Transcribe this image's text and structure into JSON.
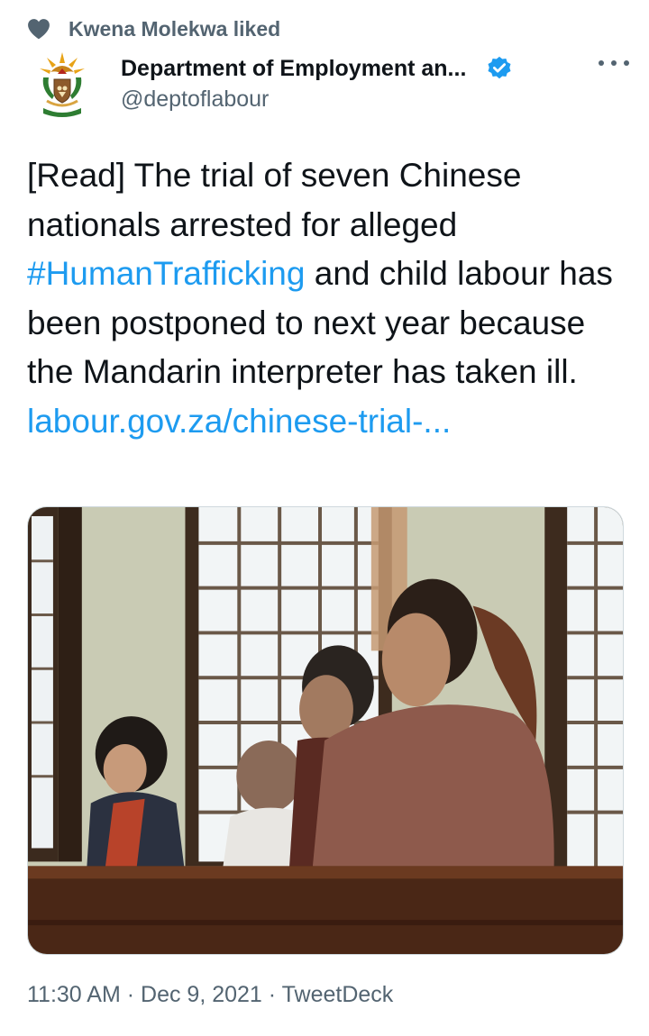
{
  "social_context": {
    "icon": "heart-icon",
    "text": "Kwena Molekwa liked"
  },
  "author": {
    "display_name": "Department of Employment an...",
    "handle": "@deptoflabour",
    "verified": true,
    "verified_color": "#1d9bf0"
  },
  "tweet": {
    "text_prefix": "[Read] The trial of seven Chinese nationals arrested for alleged ",
    "hashtag": "#HumanTrafficking",
    "text_suffix": " and child labour has been postponed to next year because the Mandarin interpreter has taken ill.",
    "link": "labour.gov.za/chinese-trial-...",
    "link_color": "#1d9bf0"
  },
  "media": {
    "type": "photo"
  },
  "meta": {
    "time": "11:30 AM",
    "separator": "·",
    "date": "Dec 9, 2021",
    "source": "TweetDeck"
  }
}
